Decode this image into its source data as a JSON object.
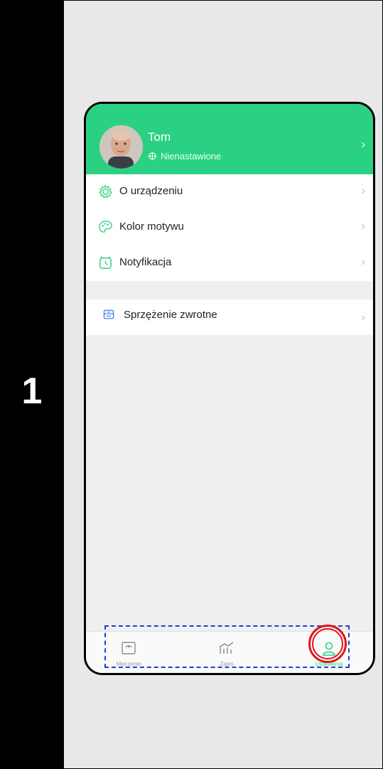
{
  "step": {
    "number": "1"
  },
  "profile": {
    "name": "Tom",
    "status": "Nienastawione",
    "chevron": "›"
  },
  "menu": {
    "group1": [
      {
        "label": "O urządzeniu",
        "icon": "gear-icon"
      },
      {
        "label": "Kolor motywu",
        "icon": "palette-icon"
      },
      {
        "label": "Notyfikacja",
        "icon": "alarm-clock-icon"
      }
    ],
    "group2": [
      {
        "label": "Sprzężenie zwrotne",
        "icon": "feedback-icon"
      }
    ],
    "chevron": "›"
  },
  "tabbar": {
    "tabs": [
      {
        "label": "Mierzenie",
        "icon": "scale-icon"
      },
      {
        "label": "Zapis",
        "icon": "chart-icon"
      },
      {
        "label": "Ustawienia",
        "icon": "user-icon",
        "active": true
      }
    ]
  },
  "colors": {
    "accent": "#2bd182",
    "annotation_box": "#1e3fd6",
    "annotation_ring": "#e0141a"
  }
}
